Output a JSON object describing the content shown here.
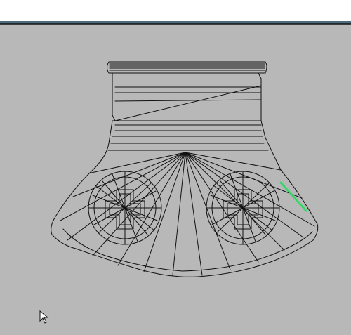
{
  "viewport": {
    "background": "#b8b8b8",
    "wire_color": "#111111",
    "highlight_color": "#38d66b",
    "model_name": ""
  },
  "cursor": {
    "icon": "arrow-cursor-icon"
  }
}
